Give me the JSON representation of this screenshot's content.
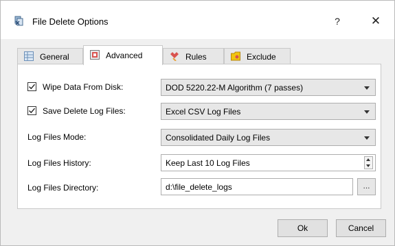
{
  "window": {
    "title": "File Delete Options",
    "help_label": "?",
    "close_label": "✕",
    "icon": "app-icon"
  },
  "tabs": [
    {
      "label": "General",
      "icon": "grid-icon"
    },
    {
      "label": "Advanced",
      "icon": "settings-icon",
      "active": true
    },
    {
      "label": "Rules",
      "icon": "tools-icon"
    },
    {
      "label": "Exclude",
      "icon": "folder-icon"
    }
  ],
  "form": {
    "wipe": {
      "label": "Wipe Data From Disk:",
      "checked": true,
      "value": "DOD 5220.22-M Algorithm (7 passes)"
    },
    "save_log": {
      "label": "Save Delete Log Files:",
      "checked": true,
      "value": "Excel CSV Log Files"
    },
    "log_mode": {
      "label": "Log Files Mode:",
      "value": "Consolidated Daily Log Files"
    },
    "log_history": {
      "label": "Log Files History:",
      "value": "Keep Last 10 Log Files"
    },
    "log_dir": {
      "label": "Log Files Directory:",
      "value": "d:\\file_delete_logs",
      "browse_label": "..."
    }
  },
  "buttons": {
    "ok": "Ok",
    "cancel": "Cancel"
  }
}
